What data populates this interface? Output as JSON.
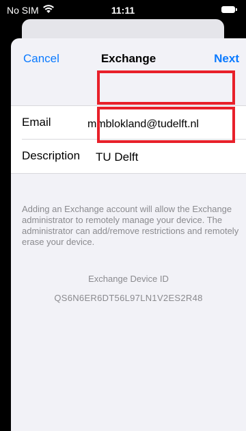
{
  "status_bar": {
    "carrier": "No SIM",
    "time": "11:11",
    "wifi_icon": "wifi-icon",
    "battery_icon": "battery-icon"
  },
  "nav": {
    "cancel_label": "Cancel",
    "title": "Exchange",
    "next_label": "Next"
  },
  "form": {
    "email": {
      "label": "Email",
      "value": "mmblokland@tudelft.nl"
    },
    "description": {
      "label": "Description",
      "value": "TU Delft"
    }
  },
  "footer": {
    "note": "Adding an Exchange account will allow the Exchange administrator to remotely manage your device. The administrator can add/remove restrictions and remotely erase your device.",
    "device_id_label": "Exchange Device ID",
    "device_id_value": "QS6N6ER6DT56L97LN1V2ES2R48"
  },
  "colors": {
    "accent": "#0a7aff",
    "highlight": "#e8202a",
    "background": "#f2f2f7"
  }
}
